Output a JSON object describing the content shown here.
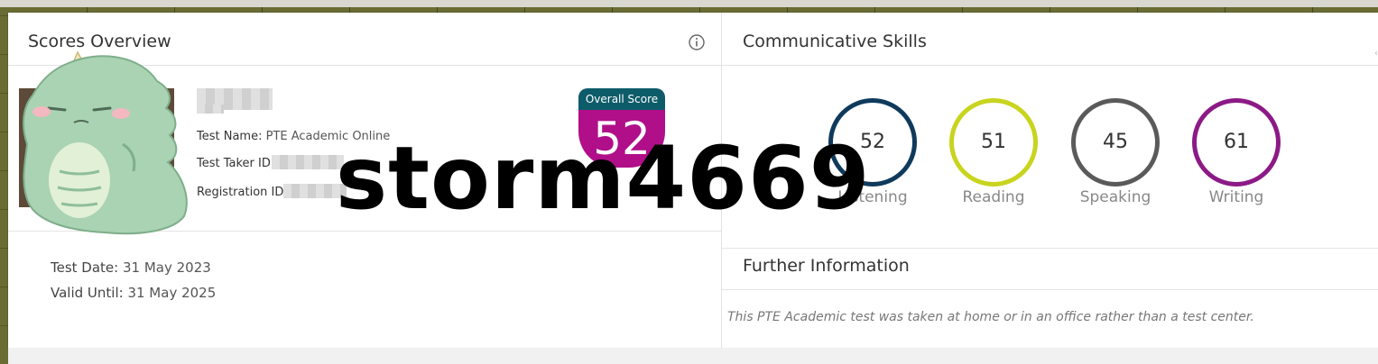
{
  "scores_overview": {
    "title": "Scores Overview",
    "test_name_label": "Test Name:",
    "test_name_value": "PTE Academic Online",
    "test_taker_id_label": "Test Taker ID:",
    "registration_id_label": "Registration ID:",
    "test_date_label": "Test Date:",
    "test_date_value": "31 May 2023",
    "valid_until_label": "Valid Until:",
    "valid_until_value": "31 May 2025",
    "overall_label": "Overall Score",
    "overall_value": "52"
  },
  "communicative_skills": {
    "title": "Communicative Skills",
    "skills": [
      {
        "name": "Listening",
        "score": "52",
        "color": "#0f3a5c"
      },
      {
        "name": "Reading",
        "score": "51",
        "color": "#c8d41e"
      },
      {
        "name": "Speaking",
        "score": "45",
        "color": "#5a5a5a"
      },
      {
        "name": "Writing",
        "score": "61",
        "color": "#8c1a86"
      }
    ]
  },
  "further_information": {
    "title": "Further Information",
    "text": "This PTE Academic test was taken at home or in an office rather than a test center."
  },
  "overlay": {
    "watermark": "storm4669"
  },
  "colors": {
    "overall_header": "#0d5c6a",
    "overall_body": "#b00f89"
  }
}
